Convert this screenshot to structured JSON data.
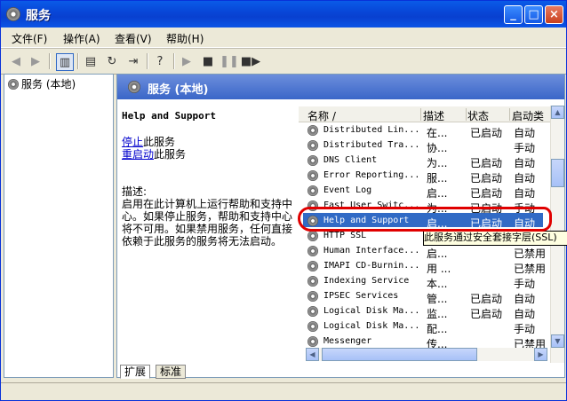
{
  "window": {
    "title": "服务",
    "minimize": "_",
    "maximize": "□",
    "close": "×"
  },
  "menu": [
    "文件(F)",
    "操作(A)",
    "查看(V)",
    "帮助(H)"
  ],
  "tree": {
    "root_label": "服务 (本地)"
  },
  "panel": {
    "header": "服务 (本地)"
  },
  "detail": {
    "service_name": "Help and Support",
    "stop_link": "停止",
    "stop_suffix": "此服务",
    "restart_link": "重启动",
    "restart_suffix": "此服务",
    "desc_label": "描述:",
    "desc_text": "启用在此计算机上运行帮助和支持中心。如果停止服务，帮助和支持中心将不可用。如果禁用服务，任何直接依赖于此服务的服务将无法启动。"
  },
  "columns": [
    "名称 /",
    "描述",
    "状态",
    "启动类"
  ],
  "services": [
    {
      "name": "Distributed Lin...",
      "desc": "在...",
      "status": "已启动",
      "startup": "自动"
    },
    {
      "name": "Distributed Tra...",
      "desc": "协...",
      "status": "",
      "startup": "手动"
    },
    {
      "name": "DNS Client",
      "desc": "为...",
      "status": "已启动",
      "startup": "自动"
    },
    {
      "name": "Error Reporting...",
      "desc": "服...",
      "status": "已启动",
      "startup": "自动"
    },
    {
      "name": "Event Log",
      "desc": "启...",
      "status": "已启动",
      "startup": "自动"
    },
    {
      "name": "Fast User Switc...",
      "desc": "为...",
      "status": "已启动",
      "startup": "手动"
    },
    {
      "name": "Help and Support",
      "desc": "启...",
      "status": "已启动",
      "startup": "自动"
    },
    {
      "name": "HTTP SSL",
      "desc": "",
      "status": "",
      "startup": ""
    },
    {
      "name": "Human Interface...",
      "desc": "启...",
      "status": "",
      "startup": "已禁用"
    },
    {
      "name": "IMAPI CD-Burnin...",
      "desc": "用 ...",
      "status": "",
      "startup": "已禁用"
    },
    {
      "name": "Indexing Service",
      "desc": "本...",
      "status": "",
      "startup": "手动"
    },
    {
      "name": "IPSEC Services",
      "desc": "管...",
      "status": "已启动",
      "startup": "自动"
    },
    {
      "name": "Logical Disk Ma...",
      "desc": "监...",
      "status": "已启动",
      "startup": "自动"
    },
    {
      "name": "Logical Disk Ma...",
      "desc": "配...",
      "status": "",
      "startup": "手动"
    },
    {
      "name": "Messenger",
      "desc": "传...",
      "status": "",
      "startup": "已禁用"
    }
  ],
  "tooltip": "此服务通过安全套接字层(SSL)",
  "tabs": [
    "扩展",
    "标准"
  ]
}
